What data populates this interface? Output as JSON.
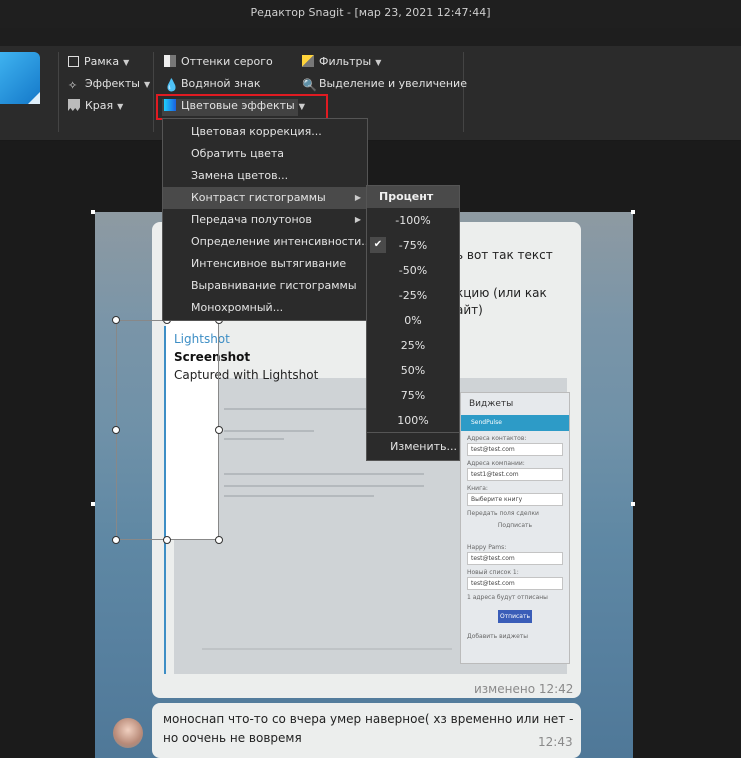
{
  "window": {
    "title": "Редактор Snagit - [мар 23, 2021 12:47:44]"
  },
  "ribbon": {
    "frame": "Рамка",
    "effects": "Эффекты",
    "edges": "Края",
    "grayscale": "Оттенки серого",
    "watermark": "Водяной знак",
    "color_effects": "Цветовые эффекты",
    "filters": "Фильтры",
    "spotlight": "Выделение и увеличение"
  },
  "color_effects_menu": {
    "items": [
      "Цветовая коррекция...",
      "Обратить цвета",
      "Замена цветов...",
      "Контраст гистограммы",
      "Передача полутонов",
      "Определение интенсивности...",
      "Интенсивное вытягивание",
      "Выравнивание гистограммы",
      "Монохромный..."
    ]
  },
  "contrast_submenu": {
    "header": "Процент",
    "options": [
      "-100%",
      "-75%",
      "-50%",
      "-25%",
      "0%",
      "25%",
      "50%",
      "75%",
      "100%"
    ],
    "checked": "-75%",
    "edit": "Изменить..."
  },
  "chat": {
    "msg1_line1": "ь вот так текст",
    "msg1_line2": "кцию  (или как",
    "msg1_line3": "айт)",
    "lightshot_brand": "Lightshot",
    "lightshot_title": "Screenshot",
    "lightshot_desc": "Captured with Lightshot",
    "msg1_time": "изменено 12:42",
    "msg2_line1": "моноснап что-то со вчера умер наверное( хз временно или нет -",
    "msg2_line2": "но оочень не вовремя",
    "msg2_time": "12:43"
  },
  "widget": {
    "title": "Виджеты",
    "bar": "SendPulse",
    "l1": "Адреса контактов:",
    "v1": "test@test.com",
    "l2": "Адреса компании:",
    "v2": "test1@test.com",
    "l3": "Книга:",
    "v3": "Выберите книгу",
    "cb": "Передать поля сделки",
    "link": "Подписать",
    "l4": "Happy Pams:",
    "v4": "test@test.com",
    "l5": "Новый список 1:",
    "v5": "test@test.com",
    "note": "1 адреса будут отписаны",
    "btn": "Отписать",
    "foot": "Добавить виджеты"
  }
}
